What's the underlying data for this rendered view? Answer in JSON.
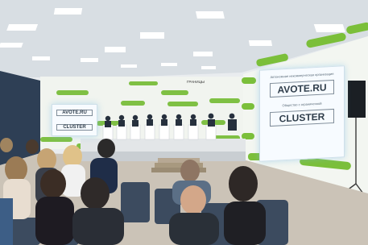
{
  "photo": {
    "right_screen": {
      "top_text": "Автономная некоммерческая организация",
      "logo_text": "AVOTE.RU",
      "mid_text": "Общество с ограниченной",
      "cluster_text": "CLUSTER"
    },
    "left_screen": {
      "logo_text": "AVOTE.RU",
      "cluster_text": "CLUSTER"
    },
    "back_banner_text": "ГРАНИЦЫ"
  },
  "colors": {
    "wall": "#f2f5f0",
    "green_accent": "#7bbf3a",
    "ceiling": "#d7dde2",
    "floor": "#cfc8bd",
    "chairs": "#3a4a5e"
  }
}
